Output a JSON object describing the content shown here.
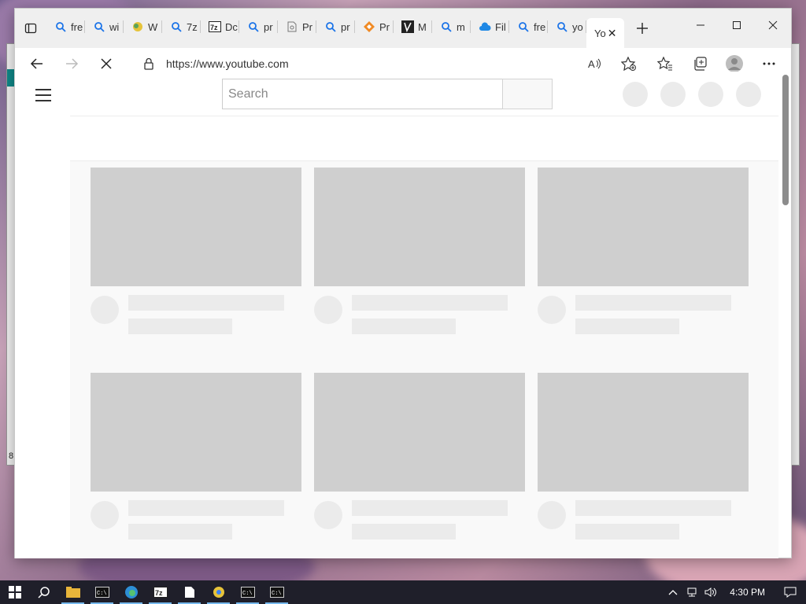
{
  "browser": {
    "tabs": [
      {
        "label": "fre",
        "icon": "search-icon"
      },
      {
        "label": "wi",
        "icon": "search-icon"
      },
      {
        "label": "W",
        "icon": "globe-icon"
      },
      {
        "label": "7z",
        "icon": "search-icon"
      },
      {
        "label": "Dc",
        "icon": "7zip-icon"
      },
      {
        "label": "pr",
        "icon": "search-icon"
      },
      {
        "label": "Pr",
        "icon": "page-icon"
      },
      {
        "label": "pr",
        "icon": "search-icon"
      },
      {
        "label": "Pr",
        "icon": "diamond-icon"
      },
      {
        "label": "M",
        "icon": "ms-icon"
      },
      {
        "label": "m",
        "icon": "search-icon"
      },
      {
        "label": "Fil",
        "icon": "cloud-icon"
      },
      {
        "label": "fre",
        "icon": "search-icon"
      },
      {
        "label": "yo",
        "icon": "search-icon"
      }
    ],
    "active_tab": {
      "label": "Yo"
    },
    "address": {
      "url": "https://www.youtube.com"
    }
  },
  "page": {
    "search": {
      "placeholder": "Search"
    }
  },
  "taskbar": {
    "clock": "4:30 PM",
    "apps": [
      "start-icon",
      "search-icon",
      "file-explorer-icon",
      "cmd-icon",
      "edge-icon",
      "7zip-icon",
      "notepad-icon",
      "chrome-icon",
      "cmd-icon",
      "cmd-icon"
    ]
  },
  "background_window": {
    "visible_text": "8"
  },
  "colors": {
    "tabstrip_bg": "#efefef",
    "skeleton_thumb": "#cfcfcf",
    "skeleton_line": "#ebebeb",
    "taskbar_bg": "#1f1f2a",
    "tab_search_icon": "#1a73e8"
  }
}
